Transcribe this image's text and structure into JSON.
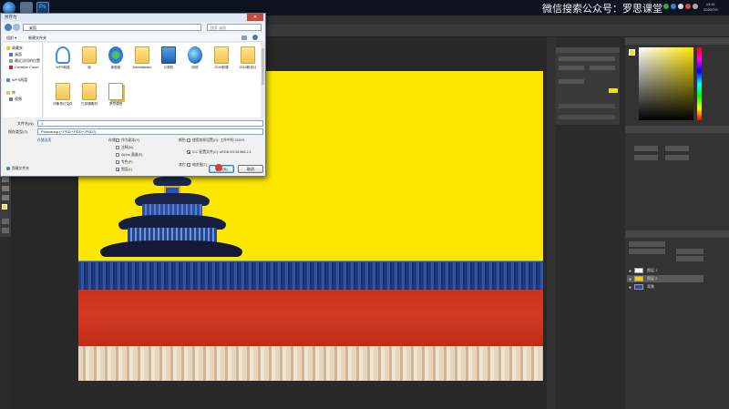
{
  "taskbar": {
    "watermark": "微信搜索公众号：罗思课堂",
    "clock_time": "14:11",
    "clock_date": "2020/7/9"
  },
  "dialog": {
    "title": "另存为",
    "close_label": "✕",
    "address_path": "桌面",
    "search_placeholder": "搜索 桌面",
    "cmd_organize": "组织 ▾",
    "cmd_new_folder": "新建文件夹",
    "nav_items": [
      {
        "label": "收藏夹",
        "icon": "star-icon"
      },
      {
        "label": "桌面",
        "icon": "desktop-icon"
      },
      {
        "label": "最近访问的位置",
        "icon": "recent-icon"
      },
      {
        "label": "Creative Cloud",
        "icon": "cloud-icon"
      },
      {
        "label": "WPS网盘",
        "icon": "cloud-icon"
      },
      {
        "label": "库",
        "icon": "library-icon"
      },
      {
        "label": "视频",
        "icon": "video-icon"
      }
    ],
    "files": [
      {
        "label": "WPS网盘",
        "icon": "cloud-folder-icon"
      },
      {
        "label": "库",
        "icon": "folder-icon"
      },
      {
        "label": "家庭组",
        "icon": "homegroup-icon"
      },
      {
        "label": "Administrator",
        "icon": "user-folder-icon"
      },
      {
        "label": "计算机",
        "icon": "computer-icon"
      },
      {
        "label": "网络",
        "icon": "network-icon"
      },
      {
        "label": "2019新课",
        "icon": "folder-icon"
      },
      {
        "label": "2019新设计",
        "icon": "folder-icon"
      },
      {
        "label": "印象笔记文件",
        "icon": "folder-icon"
      },
      {
        "label": "已剪辑素材",
        "icon": "folder-icon"
      },
      {
        "label": "罗思课堂",
        "icon": "file-icon"
      }
    ],
    "filename_label": "文件名(N):",
    "filename_value": "1",
    "format_label": "保存类型(T):",
    "format_value": "Photoshop (*.PSD;*.PDD;*.PSDT)",
    "save_options_label": "存储选项",
    "save_label": "存储:",
    "save_opts": [
      {
        "label": "作为副本(Y)",
        "checked": false
      },
      {
        "label": "注释(N)",
        "checked": false
      },
      {
        "label": "Alpha 通道(E)",
        "checked": false
      },
      {
        "label": "专色(P)",
        "checked": false
      },
      {
        "label": "图层(L)",
        "checked": true
      }
    ],
    "color_label": "颜色:",
    "color_opts": [
      {
        "label": "使用校样设置(O): 工作中的 CMYK",
        "checked": false
      },
      {
        "label": "ICC 配置文件(C): sRGB IEC61966-2.1",
        "checked": true
      }
    ],
    "other_label": "其它:",
    "thumbnail_label": "缩览图(T)",
    "hide_folders_label": "隐藏文件夹",
    "save_button": "保存(S)",
    "cancel_button": "取消"
  },
  "photoshop": {
    "swatch_fg": "#f6e100",
    "layers": [
      {
        "label": "图层 1",
        "thumb": "#ffffff",
        "selected": false
      },
      {
        "label": "图层 2",
        "thumb": "#f3d400",
        "selected": true
      },
      {
        "label": "背景",
        "thumb": "#2d53a0",
        "selected": false
      }
    ]
  }
}
